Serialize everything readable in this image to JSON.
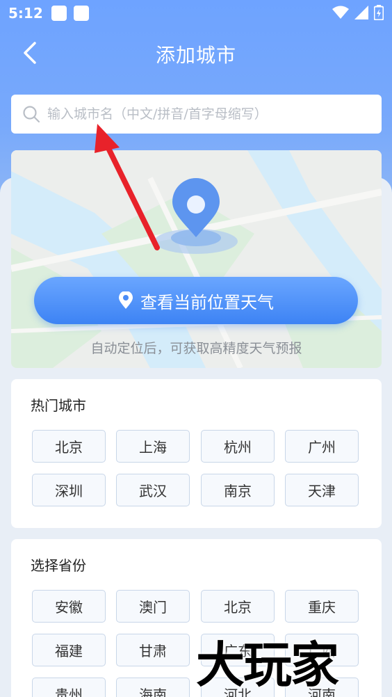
{
  "status": {
    "time": "5:12"
  },
  "nav": {
    "title": "添加城市",
    "back_icon": "chevron-left-icon"
  },
  "search": {
    "placeholder": "输入城市名（中文/拼音/首字母缩写）",
    "value": ""
  },
  "location": {
    "button_label": "查看当前位置天气",
    "hint": "自动定位后，可获取高精度天气预报"
  },
  "hot_cities": {
    "title": "热门城市",
    "items": [
      "北京",
      "上海",
      "杭州",
      "广州",
      "深圳",
      "武汉",
      "南京",
      "天津"
    ]
  },
  "provinces": {
    "title": "选择省份",
    "items": [
      "安徽",
      "澳门",
      "北京",
      "重庆",
      "福建",
      "甘肃",
      "广东",
      "广西",
      "贵州",
      "海南",
      "河北",
      "河南"
    ]
  },
  "watermark": "大玩家",
  "colors": {
    "accent": "#3d83f4",
    "header": "#6ea3ff",
    "annotation_arrow": "#e8222a"
  }
}
